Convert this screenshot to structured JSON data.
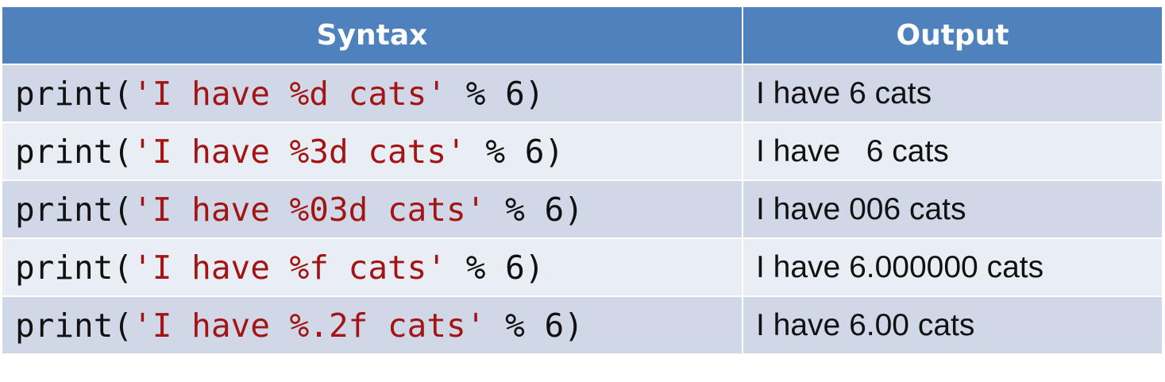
{
  "colors": {
    "header_bg": "#4f81bd",
    "row_odd_bg": "#d0d8e8",
    "row_even_bg": "#e9edf4",
    "string_color": "#a31515"
  },
  "header": {
    "syntax": "Syntax",
    "output": "Output"
  },
  "rows": [
    {
      "pre": "print(",
      "str": "'I have %d cats'",
      "post": " % 6)",
      "output": "I have 6 cats"
    },
    {
      "pre": "print(",
      "str": "'I have %3d cats'",
      "post": " % 6)",
      "output": "I have   6 cats"
    },
    {
      "pre": "print(",
      "str": "'I have %03d cats'",
      "post": " % 6)",
      "output": "I have 006 cats"
    },
    {
      "pre": "print(",
      "str": "'I have %f cats'",
      "post": " % 6)",
      "output": "I have 6.000000 cats"
    },
    {
      "pre": "print(",
      "str": "'I have %.2f cats'",
      "post": " % 6)",
      "output": "I have 6.00 cats"
    }
  ]
}
